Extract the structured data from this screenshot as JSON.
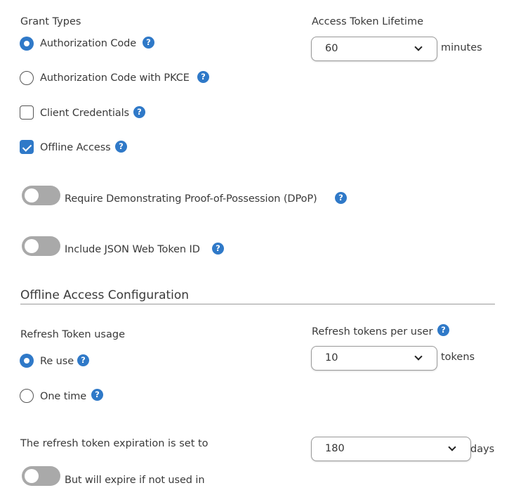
{
  "grant_types": {
    "title": "Grant Types",
    "options": [
      {
        "label": "Authorization Code",
        "type": "radio",
        "checked": true
      },
      {
        "label": "Authorization Code with PKCE",
        "type": "radio",
        "checked": false
      },
      {
        "label": "Client Credentials",
        "type": "checkbox",
        "checked": false
      },
      {
        "label": "Offline Access",
        "type": "checkbox",
        "checked": true
      }
    ],
    "help_icon": "question-circle-icon"
  },
  "access_token_lifetime": {
    "label": "Access Token Lifetime",
    "value": "60",
    "unit": "minutes"
  },
  "toggles": [
    {
      "label": "Require Demonstrating Proof-of-Possession (DPoP)",
      "on": false
    },
    {
      "label": "Include JSON Web Token ID",
      "on": false
    }
  ],
  "offline_access": {
    "section_title": "Offline Access Configuration",
    "refresh_token_usage": {
      "label": "Refresh Token usage",
      "options": [
        {
          "label": "Re use",
          "checked": true
        },
        {
          "label": "One time",
          "checked": false
        }
      ]
    },
    "refresh_tokens_per_user": {
      "label": "Refresh tokens per user",
      "value": "10",
      "unit": "tokens"
    },
    "expiration": {
      "label": "The refresh token expiration is set to",
      "value": "180",
      "unit": "days"
    },
    "expire_if_unused": {
      "label": "But will expire if not used in",
      "on": false
    }
  },
  "colors": {
    "accent": "#2f79c8",
    "toggle_off": "#a9a9a9",
    "text": "#3a3a3a"
  }
}
